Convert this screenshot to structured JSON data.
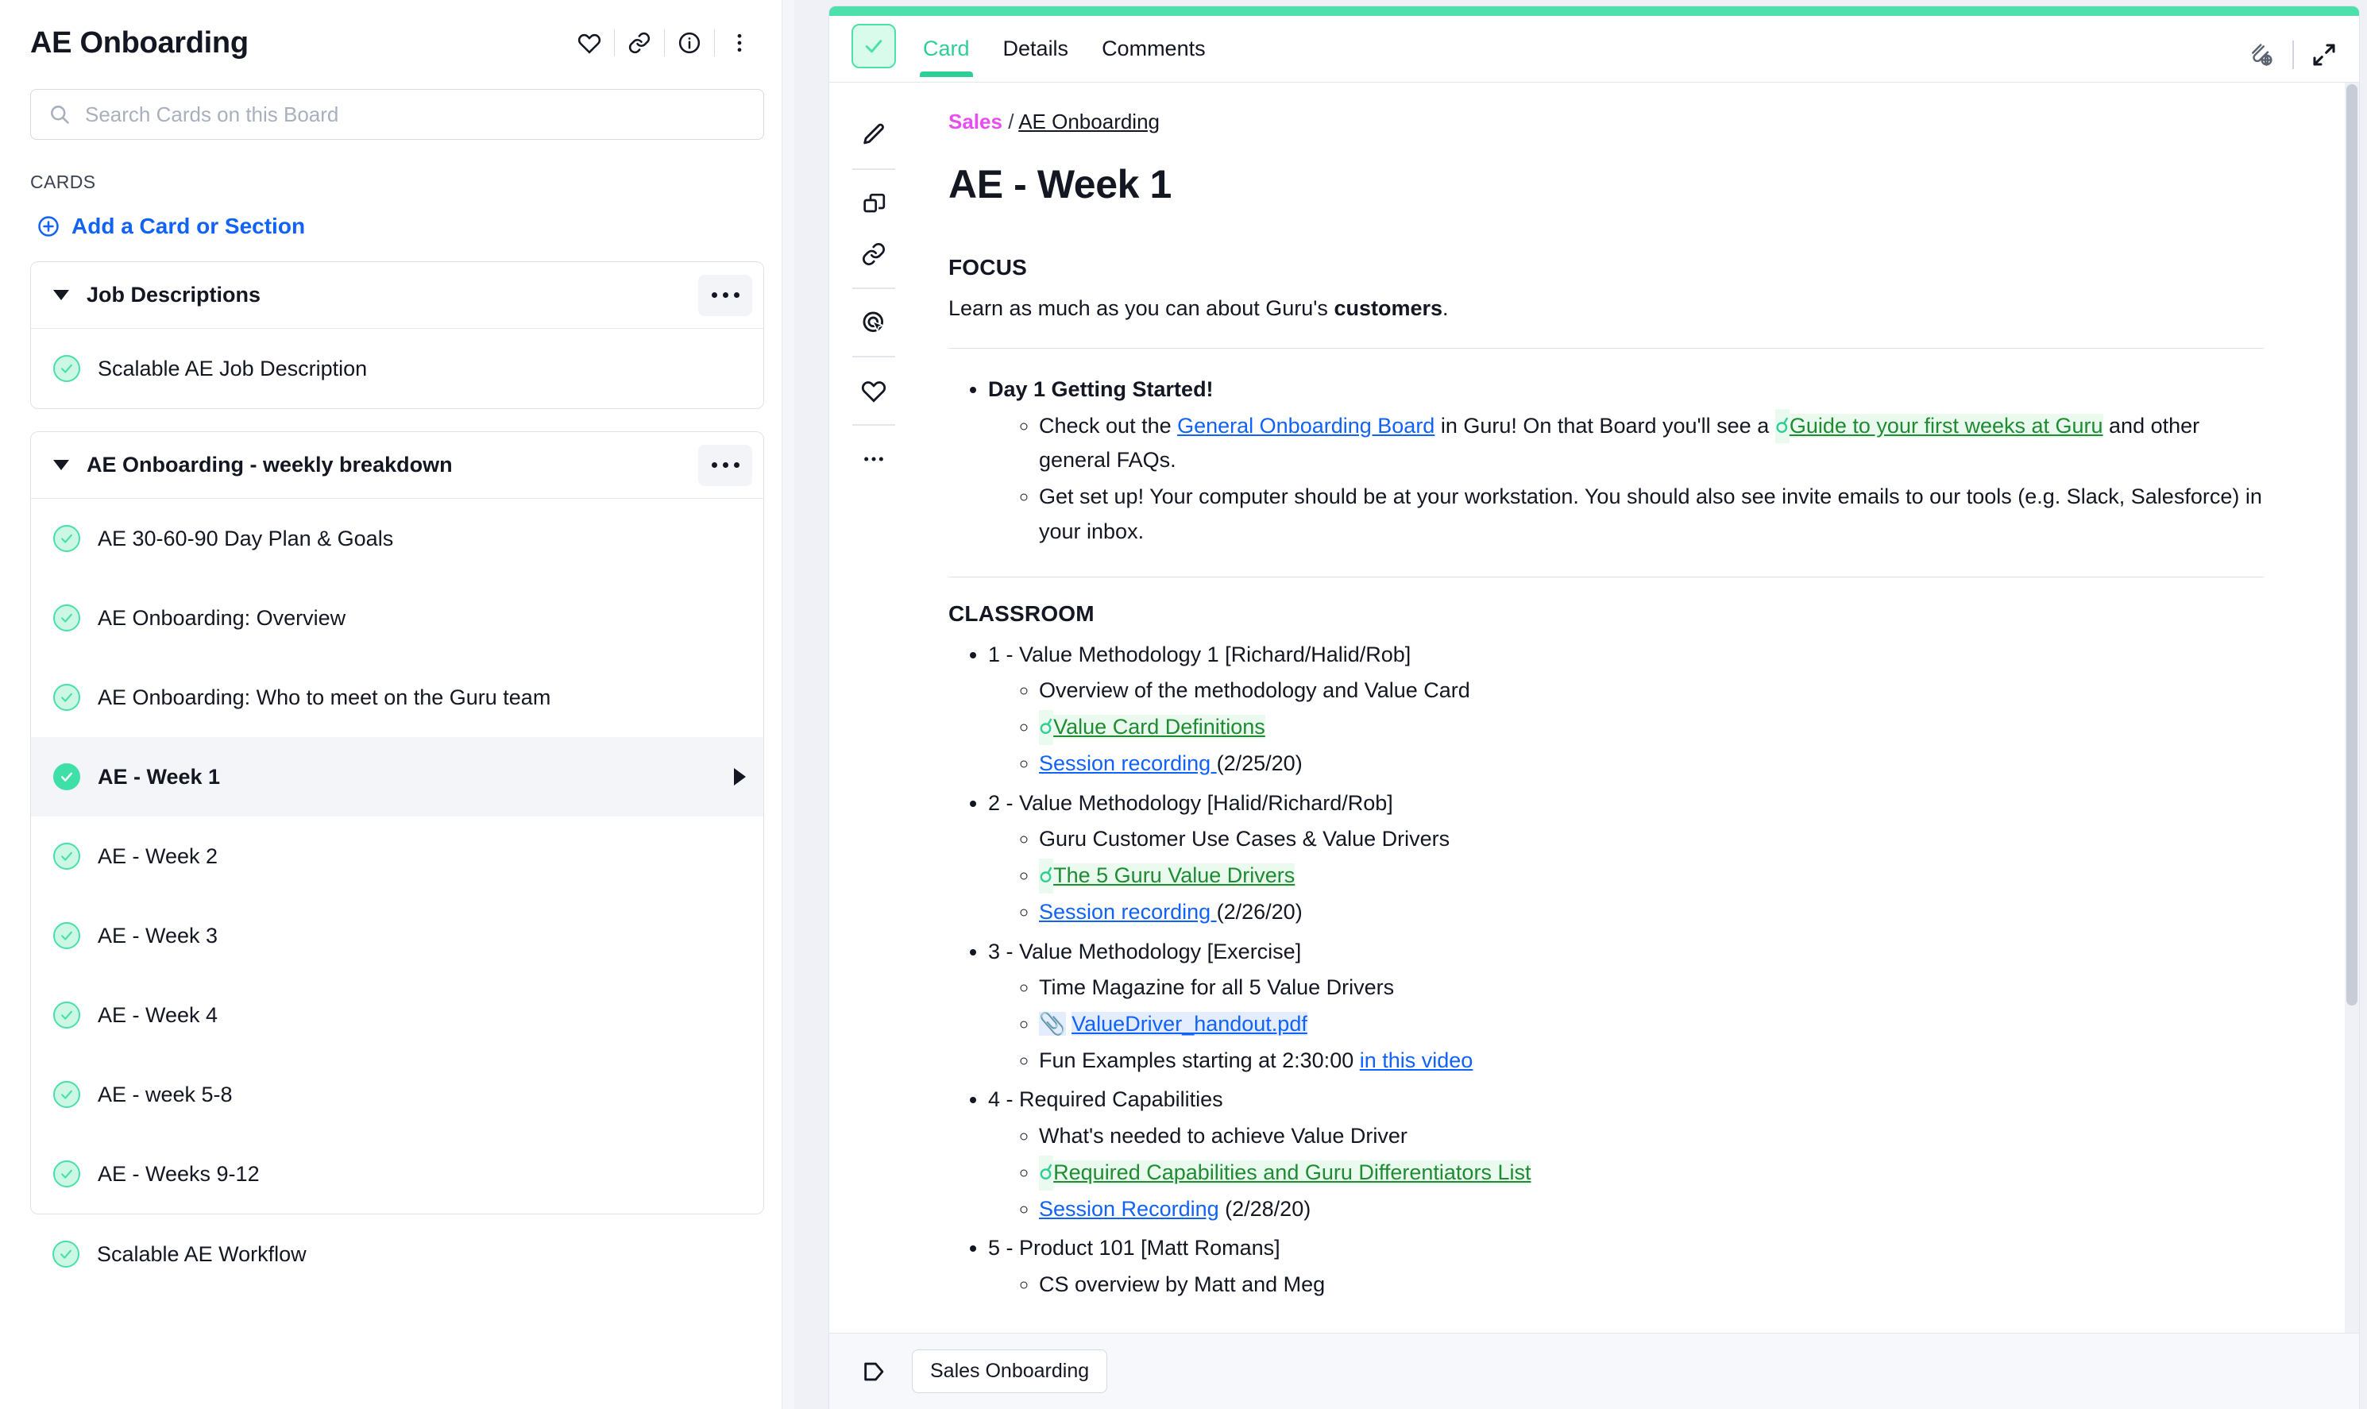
{
  "sidebar": {
    "board_title": "AE Onboarding",
    "header_icons": [
      "heart-icon",
      "link-icon",
      "info-icon",
      "more-vertical-icon"
    ],
    "search": {
      "placeholder": "Search Cards on this Board",
      "value": ""
    },
    "cards_label": "CARDS",
    "add_label": "Add a Card or Section",
    "sections": [
      {
        "title": "Job Descriptions",
        "cards": [
          {
            "label": "Scalable AE Job Description",
            "selected": false
          }
        ]
      },
      {
        "title": "AE Onboarding - weekly breakdown",
        "cards": [
          {
            "label": "AE 30-60-90 Day Plan & Goals",
            "selected": false
          },
          {
            "label": "AE Onboarding: Overview",
            "selected": false
          },
          {
            "label": "AE Onboarding: Who to meet on the Guru team",
            "selected": false
          },
          {
            "label": "AE - Week 1",
            "selected": true
          },
          {
            "label": "AE - Week 2",
            "selected": false
          },
          {
            "label": "AE - Week 3",
            "selected": false
          },
          {
            "label": "AE - Week 4",
            "selected": false
          },
          {
            "label": "AE - week 5-8",
            "selected": false
          },
          {
            "label": "AE - Weeks 9-12",
            "selected": false
          }
        ]
      }
    ],
    "loose_cards": [
      {
        "label": "Scalable AE Workflow"
      }
    ]
  },
  "panel": {
    "tabs": [
      {
        "label": "Card",
        "active": true
      },
      {
        "label": "Details",
        "active": false
      },
      {
        "label": "Comments",
        "active": false
      }
    ],
    "verified_icon": "verified-check-icon",
    "head_right_icons": [
      "share-globe-icon",
      "expand-icon"
    ],
    "tools": [
      "edit-pencil-icon",
      "duplicate-icon",
      "link-icon",
      "click-target-icon",
      "heart-icon",
      "more-horizontal-icon"
    ],
    "breadcrumb": {
      "group": "Sales",
      "separator": "/",
      "board": "AE Onboarding"
    },
    "card_title": "AE - Week 1",
    "focus": {
      "heading": "FOCUS",
      "text_before": "Learn as much as you can about Guru's ",
      "text_bold": "customers",
      "text_after": "."
    },
    "day1": {
      "heading": "Day 1 Getting Started!",
      "item1": {
        "p1": "Check out the ",
        "link1": "General Onboarding Board",
        "p2": " in Guru! On that Board you'll see a ",
        "link2": "Guide to your first weeks at Guru",
        "p3": " and other general FAQs."
      },
      "item2": "Get set up! Your computer should be at your workstation. You should also see invite emails to our tools (e.g. Slack, Salesforce) in your inbox."
    },
    "classroom": {
      "heading": "CLASSROOM",
      "items": [
        {
          "title": "1 - Value Methodology 1 [Richard/Halid/Rob]",
          "subs": [
            {
              "kind": "text",
              "text": "Overview of the methodology and Value Card"
            },
            {
              "kind": "guru-link",
              "text": "Value Card Definitions"
            },
            {
              "kind": "link-plus",
              "link": "Session recording ",
              "tail": "(2/25/20)"
            }
          ]
        },
        {
          "title": "2 - Value Methodology [Halid/Richard/Rob]",
          "subs": [
            {
              "kind": "text",
              "text": "Guru Customer Use Cases & Value Drivers"
            },
            {
              "kind": "guru-link",
              "text": "The 5 Guru Value Drivers"
            },
            {
              "kind": "link-plus",
              "link": "Session recording ",
              "tail": "(2/26/20)"
            }
          ]
        },
        {
          "title": "3 - Value Methodology [Exercise]",
          "subs": [
            {
              "kind": "text",
              "text": "Time Magazine for all 5 Value Drivers"
            },
            {
              "kind": "attachment",
              "text": "ValueDriver_handout.pdf"
            },
            {
              "kind": "text-link-tail",
              "lead": "Fun Examples starting at 2:30:00 ",
              "link": "in this video"
            }
          ]
        },
        {
          "title": "4 - Required Capabilities",
          "subs": [
            {
              "kind": "text",
              "text": "What's needed to achieve Value Driver"
            },
            {
              "kind": "guru-link",
              "text": "Required Capabilities and Guru Differentiators List"
            },
            {
              "kind": "link-plus",
              "link": "Session Recording",
              "tail": " (2/28/20)"
            }
          ]
        },
        {
          "title": "5 - Product 101 [Matt Romans]",
          "subs": [
            {
              "kind": "text",
              "text": "CS overview by Matt and Meg"
            }
          ]
        }
      ]
    },
    "footer": {
      "tag_icon": "tag-icon",
      "tag": "Sales Onboarding"
    }
  },
  "colors": {
    "accent_green": "#4ee0ab",
    "tab_active_green": "#2ecf96",
    "link_blue": "#1062f8",
    "guru_link_green": "#1f8b32",
    "breadcrumb_magenta": "#e84df0",
    "selected_row_bg": "#f3f5f9"
  }
}
